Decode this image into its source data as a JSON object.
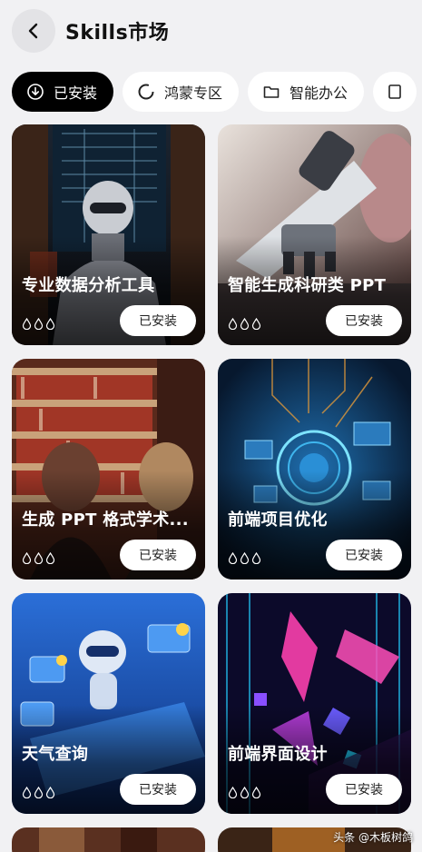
{
  "header": {
    "title": "Skills市场"
  },
  "tabs": [
    {
      "label": "已安装",
      "icon": "download-circle-icon",
      "active": true
    },
    {
      "label": "鸿蒙专区",
      "icon": "harmony-ring-icon",
      "active": false
    },
    {
      "label": "智能办公",
      "icon": "folder-icon",
      "active": false
    }
  ],
  "cards": [
    {
      "name": "专业数据分析工具",
      "button": "已安装"
    },
    {
      "name": "智能生成科研类 PPT",
      "button": "已安装"
    },
    {
      "name": "生成 PPT 格式学术...",
      "button": "已安装"
    },
    {
      "name": "前端项目优化",
      "button": "已安装"
    },
    {
      "name": "天气查询",
      "button": "已安装"
    },
    {
      "name": "前端界面设计",
      "button": "已安装"
    }
  ],
  "icons": {
    "back": "chevron-left-icon",
    "rating": "drop-icon"
  },
  "watermark": "头条 @木板树鸽",
  "colors": {
    "background": "#f1f1f3",
    "active_tab": "#000000",
    "tab": "#ffffff"
  }
}
